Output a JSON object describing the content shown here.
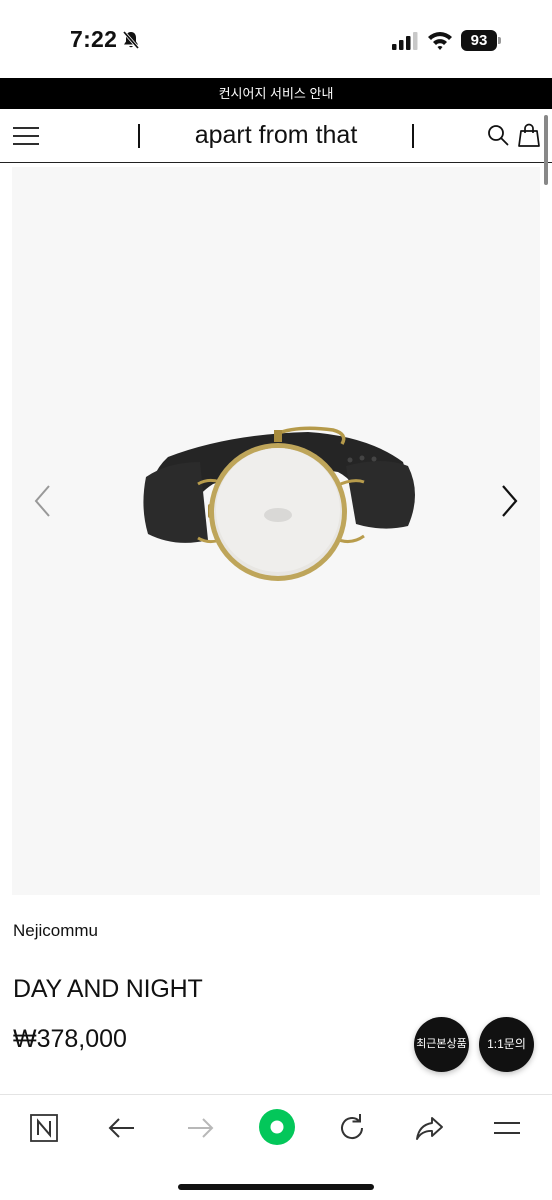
{
  "status_bar": {
    "time": "7:22",
    "battery": "93",
    "icons": [
      "bell-slash-icon",
      "signal-icon",
      "wifi-icon",
      "battery-icon"
    ]
  },
  "notice_bar": {
    "text": "컨시어지 서비스 안내"
  },
  "header": {
    "title": "apart from that",
    "icons": [
      "menu-icon",
      "search-icon",
      "shopping-bag-icon"
    ]
  },
  "gallery": {
    "image_subject": "watch-with-black-leather-strap",
    "prev_icon": "chevron-left-icon",
    "next_icon": "chevron-right-icon"
  },
  "product": {
    "brand": "Nejicommu",
    "name": "DAY AND NIGHT",
    "price": "₩378,000"
  },
  "floating_buttons": {
    "recent_label": "최근본상품",
    "inquiry_label": "1:1문의"
  },
  "browser_toolbar": {
    "icons": [
      "naver-n-icon",
      "back-arrow-icon",
      "forward-arrow-icon",
      "green-circle-home-icon",
      "refresh-icon",
      "share-icon",
      "menu-lines-icon"
    ],
    "accent_color": "#03c75a"
  }
}
